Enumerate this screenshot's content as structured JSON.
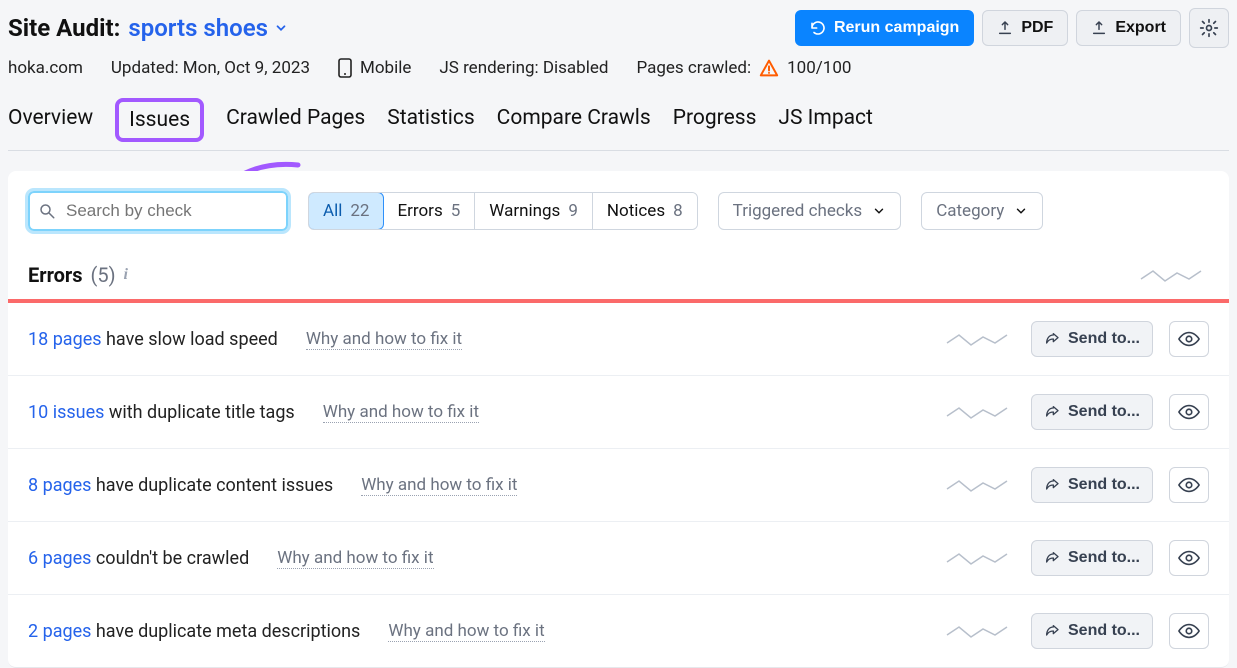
{
  "header": {
    "title_prefix": "Site Audit:",
    "project_name": "sports shoes",
    "domain": "hoka.com",
    "updated_label": "Updated: Mon, Oct 9, 2023",
    "device": "Mobile",
    "js_rendering": "JS rendering: Disabled",
    "pages_crawled_label": "Pages crawled:",
    "pages_crawled_value": "100/100"
  },
  "actions": {
    "rerun": "Rerun campaign",
    "pdf": "PDF",
    "export": "Export"
  },
  "tabs": [
    "Overview",
    "Issues",
    "Crawled Pages",
    "Statistics",
    "Compare Crawls",
    "Progress",
    "JS Impact"
  ],
  "filters": {
    "search_placeholder": "Search by check",
    "segments": [
      {
        "label": "All",
        "count": "22"
      },
      {
        "label": "Errors",
        "count": "5"
      },
      {
        "label": "Warnings",
        "count": "9"
      },
      {
        "label": "Notices",
        "count": "8"
      }
    ],
    "triggered_label": "Triggered checks",
    "category_label": "Category"
  },
  "section": {
    "title": "Errors",
    "count": "(5)"
  },
  "rows": [
    {
      "metric": "18 pages",
      "text": " have slow load speed",
      "fix": "Why and how to fix it",
      "sendto": "Send to..."
    },
    {
      "metric": "10 issues",
      "text": " with duplicate title tags",
      "fix": "Why and how to fix it",
      "sendto": "Send to..."
    },
    {
      "metric": "8 pages",
      "text": " have duplicate content issues",
      "fix": "Why and how to fix it",
      "sendto": "Send to..."
    },
    {
      "metric": "6 pages",
      "text": " couldn't be crawled",
      "fix": "Why and how to fix it",
      "sendto": "Send to..."
    },
    {
      "metric": "2 pages",
      "text": " have duplicate meta descriptions",
      "fix": "Why and how to fix it",
      "sendto": "Send to..."
    }
  ]
}
